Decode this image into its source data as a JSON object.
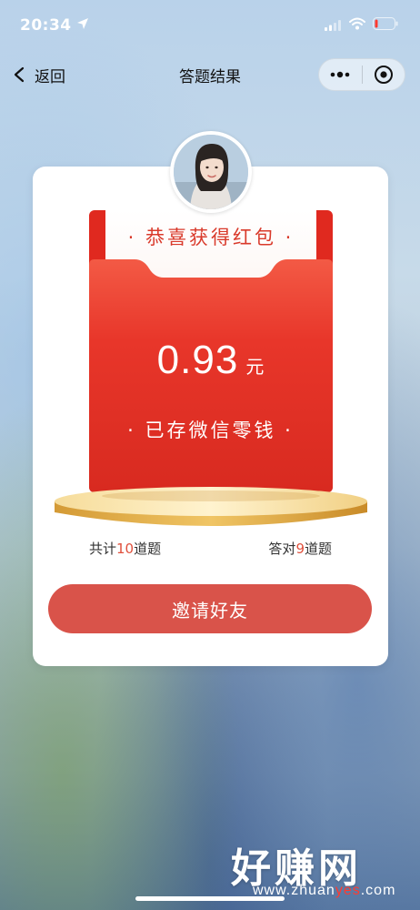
{
  "status_bar": {
    "time": "20:34",
    "icons": [
      "location-arrow-icon",
      "signal-icon",
      "wifi-icon",
      "battery-icon"
    ]
  },
  "nav": {
    "back_label": "返回",
    "title": "答题结果",
    "capsule_icons": [
      "more-dots-icon",
      "close-circle-icon"
    ]
  },
  "result": {
    "avatar": "avatar",
    "paper_title": "· 恭喜获得红包 ·",
    "amount": "0.93",
    "unit": "元",
    "saved_text": "· 已存微信零钱 ·",
    "total_prefix": "共计",
    "total_num": "10",
    "total_suffix": "道题",
    "correct_prefix": "答对",
    "correct_num": "9",
    "correct_suffix": "道题",
    "invite_label": "邀请好友"
  },
  "watermark": {
    "title": "好赚网",
    "url_pre": "www.zhuan",
    "url_hl": "yes",
    "url_post": ".com"
  },
  "colors": {
    "red": "#e0291f",
    "button": "#d9534a",
    "gold": "#e6b85a",
    "highlight_number": "#e0503c"
  }
}
